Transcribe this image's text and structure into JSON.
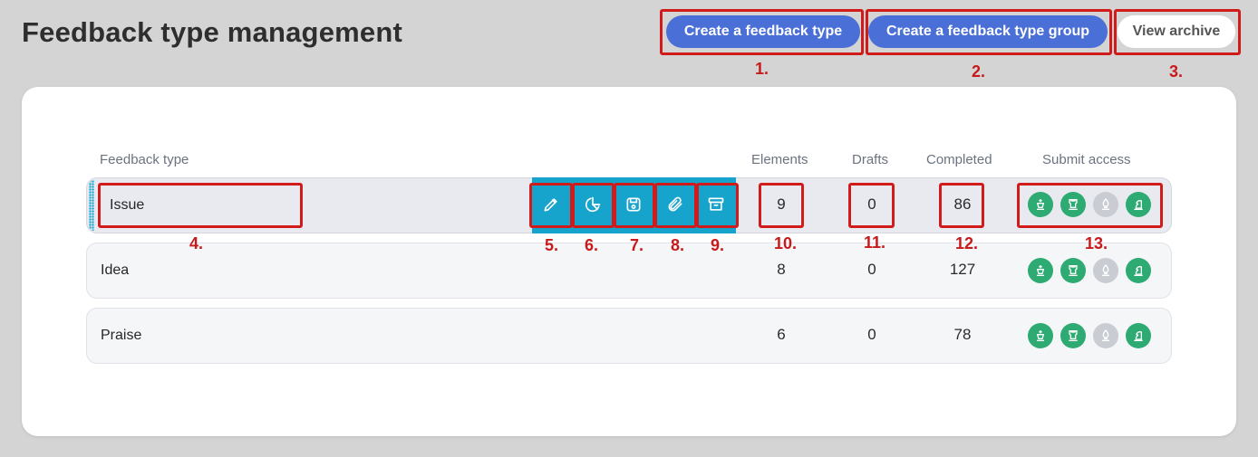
{
  "header": {
    "title": "Feedback type management",
    "create_type_label": "Create a feedback type",
    "create_group_label": "Create a feedback type group",
    "view_archive_label": "View archive"
  },
  "table": {
    "columns": {
      "type": "Feedback type",
      "elements": "Elements",
      "drafts": "Drafts",
      "completed": "Completed",
      "access": "Submit access"
    },
    "rows": [
      {
        "name": "Issue",
        "elements": "9",
        "drafts": "0",
        "completed": "86"
      },
      {
        "name": "Idea",
        "elements": "8",
        "drafts": "0",
        "completed": "127"
      },
      {
        "name": "Praise",
        "elements": "6",
        "drafts": "0",
        "completed": "78"
      }
    ]
  },
  "row_actions": [
    "edit-icon",
    "chart-icon",
    "save-icon",
    "attachment-icon",
    "archive-icon"
  ],
  "submit_access_icons": [
    {
      "icon": "role-crown-icon",
      "enabled": true
    },
    {
      "icon": "role-tower-icon",
      "enabled": true
    },
    {
      "icon": "role-bishop-icon",
      "enabled": false
    },
    {
      "icon": "role-knight-icon",
      "enabled": true
    }
  ],
  "callouts": [
    "1.",
    "2.",
    "3.",
    "4.",
    "5.",
    "6.",
    "7.",
    "8.",
    "9.",
    "10.",
    "11.",
    "12.",
    "13."
  ],
  "colors": {
    "primary": "#4a6fd6",
    "action_bar": "#16a3cc",
    "access_on": "#2eaa73",
    "access_off": "#c9ccd2",
    "callout": "#d11b1b"
  }
}
